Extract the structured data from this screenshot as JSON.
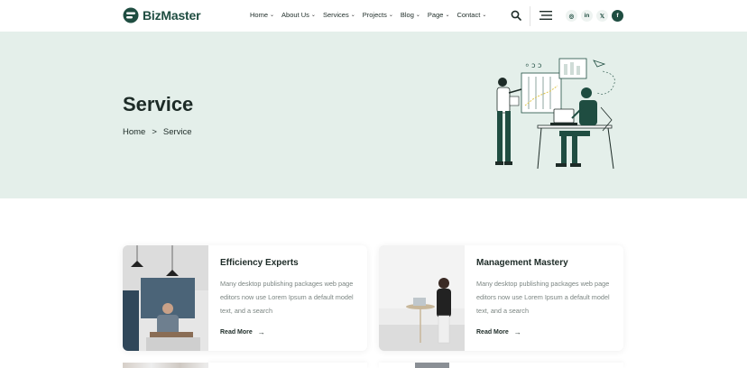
{
  "header": {
    "brand": "BizMaster",
    "nav": [
      {
        "label": "Home"
      },
      {
        "label": "About Us"
      },
      {
        "label": "Services"
      },
      {
        "label": "Projects"
      },
      {
        "label": "Blog"
      },
      {
        "label": "Page"
      },
      {
        "label": "Contact"
      }
    ],
    "social": {
      "instagram": "◎",
      "linkedin": "in",
      "x": "𝕏",
      "facebook": "f"
    },
    "icons": {
      "search": "search-icon",
      "menu": "hamburger-menu-icon"
    }
  },
  "hero": {
    "title": "Service",
    "breadcrumb": {
      "home": "Home",
      "separator": ">",
      "current": "Service"
    }
  },
  "cards": [
    {
      "title": "Efficiency Experts",
      "description": "Many desktop publishing packages web page editors now use Lorem Ipsum a default model text, and a search",
      "link": "Read More",
      "arrow": "→"
    },
    {
      "title": "Management Mastery",
      "description": "Many desktop publishing packages web page editors now use Lorem Ipsum a default model text, and a search",
      "link": "Read More",
      "arrow": "→"
    }
  ],
  "colors": {
    "brand": "#1f4d41",
    "hero_bg": "#e4efea",
    "text": "#1d2b27",
    "muted": "#7b8582"
  }
}
